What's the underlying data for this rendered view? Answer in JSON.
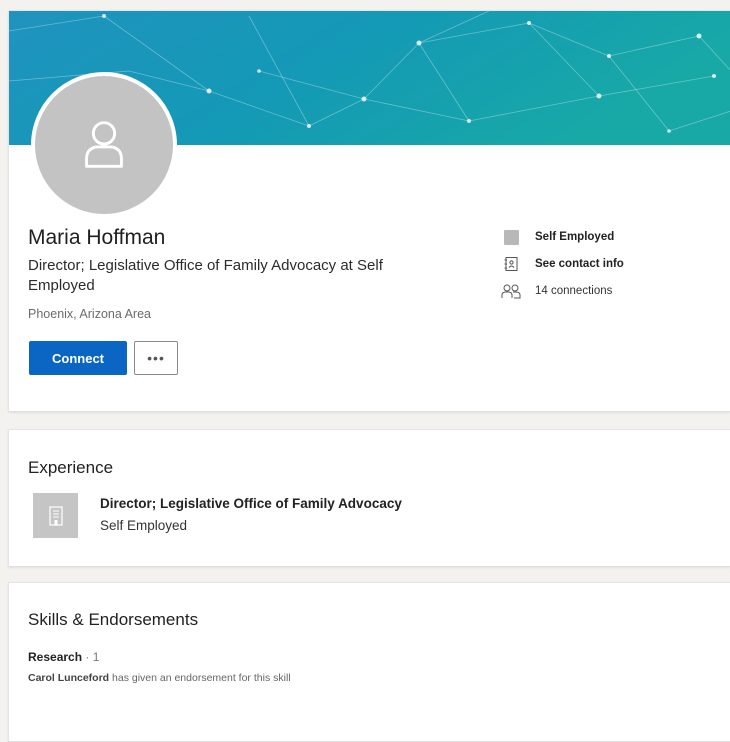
{
  "profile": {
    "name": "Maria Hoffman",
    "headline": "Director; Legislative Office of Family Advocacy at Self Employed",
    "location": "Phoenix, Arizona Area",
    "connect_label": "Connect",
    "more_label": "•••",
    "side_info": {
      "company": "Self Employed",
      "contact": "See contact info",
      "connections": "14 connections"
    },
    "banner_colors": [
      "#1c8fb6",
      "#0f9db8",
      "#12a8a8"
    ]
  },
  "experience": {
    "title": "Experience",
    "items": [
      {
        "position": "Director; Legislative Office of Family Advocacy",
        "company": "Self Employed"
      }
    ]
  },
  "skills": {
    "title": "Skills & Endorsements",
    "items": [
      {
        "name": "Research",
        "count": " · 1",
        "endorser": "Carol Lunceford",
        "endorse_text": " has given an endorsement for this skill"
      }
    ]
  },
  "colors": {
    "accent": "#0a66c2",
    "avatar_bg": "#c3c3c3"
  }
}
